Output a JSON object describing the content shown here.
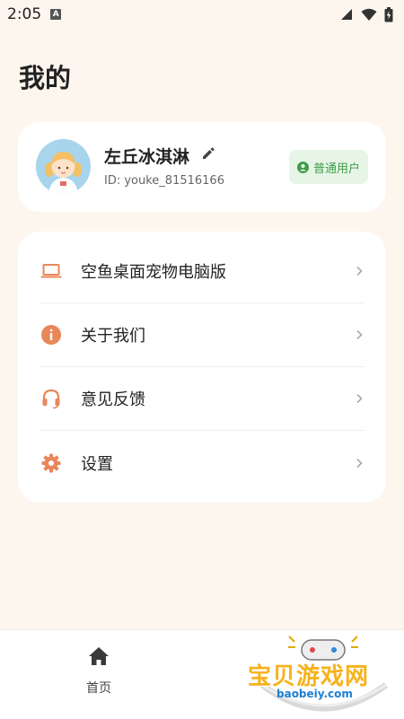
{
  "status_bar": {
    "time": "2:05",
    "app_icon_letter": "A",
    "icons": [
      "signal-icon",
      "wifi-icon",
      "battery-icon"
    ]
  },
  "page": {
    "title": "我的"
  },
  "profile": {
    "name": "左丘冰淇淋",
    "id_text": "ID: youke_81516166",
    "badge": "普通用户",
    "badge_color": "#3f9c49",
    "avatar_icon": "avatar-girl-icon",
    "edit_icon": "pencil-icon"
  },
  "menu": {
    "items": [
      {
        "label": "空鱼桌面宠物电脑版",
        "icon": "laptop-icon"
      },
      {
        "label": "关于我们",
        "icon": "info-icon"
      },
      {
        "label": "意见反馈",
        "icon": "headset-icon"
      },
      {
        "label": "设置",
        "icon": "gear-icon"
      }
    ],
    "accent_color": "#e8875a"
  },
  "bottom_nav": {
    "items": [
      {
        "label": "首页",
        "icon": "home-icon"
      }
    ]
  },
  "watermark": {
    "title": "宝贝游戏网",
    "url": "baobeiy.com"
  }
}
